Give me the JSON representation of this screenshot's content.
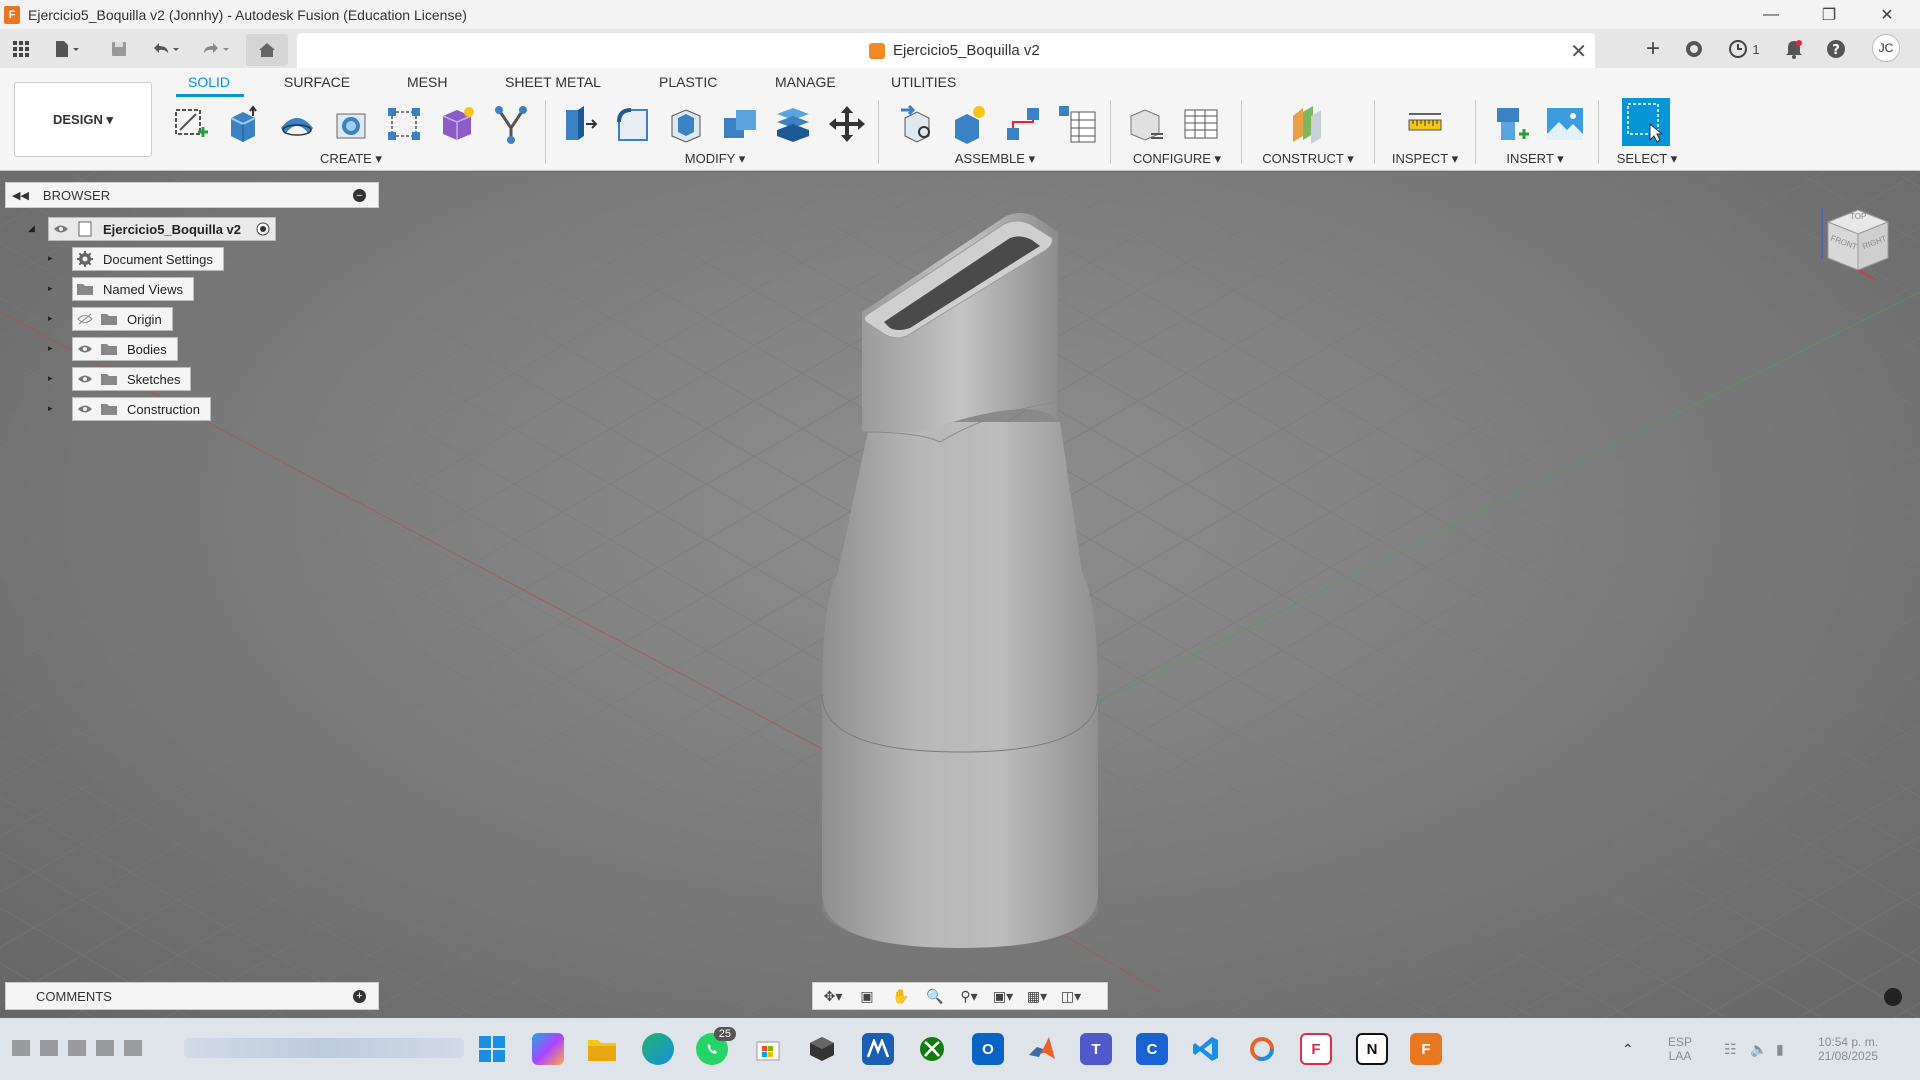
{
  "window": {
    "title": "Ejercicio5_Boquilla v2 (Jonnhy) - Autodesk Fusion (Education License)",
    "app_icon_letter": "F"
  },
  "document_tab": {
    "title": "Ejercicio5_Boquilla v2",
    "close_label": "✕",
    "new_tab_label": "+"
  },
  "top_right": {
    "job_count": "1",
    "user_initials": "JC"
  },
  "ribbon": {
    "workspace_button": "DESIGN ▾",
    "tabs": [
      "SOLID",
      "SURFACE",
      "MESH",
      "SHEET METAL",
      "PLASTIC",
      "MANAGE",
      "UTILITIES"
    ],
    "active_tab": "SOLID",
    "groups": {
      "create": "CREATE ▾",
      "modify": "MODIFY ▾",
      "assemble": "ASSEMBLE ▾",
      "configure": "CONFIGURE ▾",
      "construct": "CONSTRUCT ▾",
      "inspect": "INSPECT ▾",
      "insert": "INSERT ▾",
      "select": "SELECT ▾"
    }
  },
  "browser": {
    "header": "BROWSER",
    "root": "Ejercicio5_Boquilla v2",
    "items": [
      {
        "label": "Document Settings",
        "icon": "gear-icon"
      },
      {
        "label": "Named Views",
        "icon": "folder-icon"
      },
      {
        "label": "Origin",
        "icon": "folder-icon",
        "visibility": "hidden"
      },
      {
        "label": "Bodies",
        "icon": "folder-icon",
        "visibility": "visible"
      },
      {
        "label": "Sketches",
        "icon": "folder-icon",
        "visibility": "visible"
      },
      {
        "label": "Construction",
        "icon": "folder-icon",
        "visibility": "visible"
      }
    ]
  },
  "comments": {
    "label": "COMMENTS"
  },
  "viewcube": {
    "faces": [
      "TOP",
      "FRONT",
      "RIGHT"
    ]
  },
  "taskbar": {
    "whatsapp_badge": "25",
    "language_line1": "ESP",
    "language_line2": "LAA",
    "time": "10:54 p. m.",
    "date": "21/08/2025"
  },
  "colors": {
    "accent": "#0696d7",
    "model_gray": "#b5b5b5",
    "fusion_orange": "#e87722"
  }
}
